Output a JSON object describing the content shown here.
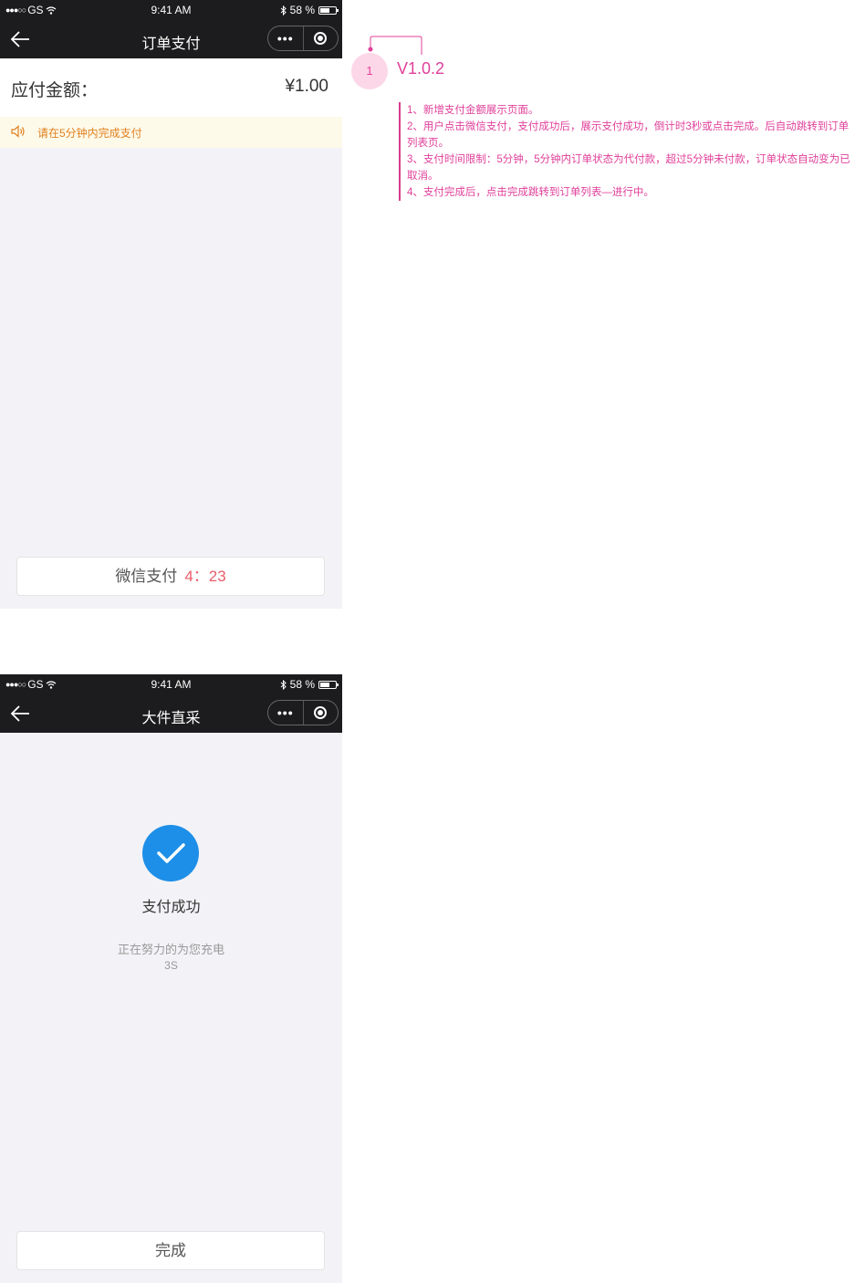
{
  "status_bar": {
    "signal": "●●●○○",
    "carrier": "GS",
    "time": "9:41 AM",
    "battery": "58 %"
  },
  "screen1": {
    "title": "订单支付",
    "amount_label": "应付金额：",
    "amount_value": "¥1.00",
    "notice": "请在5分钟内完成支付",
    "pay_button_label": "微信支付",
    "countdown": "4：23"
  },
  "screen2": {
    "title": "大件直采",
    "success_title": "支付成功",
    "charging_text": "正在努力的为您充电",
    "seconds": "3S",
    "done_button_label": "完成"
  },
  "annotation": {
    "marker": "1",
    "version": "V1.0.2",
    "notes": [
      "1、新增支付金额展示页面。",
      "2、用户点击微信支付，支付成功后，展示支付成功，倒计时3秒或点击完成。后自动跳转到订单列表页。",
      "3、支付时间限制：5分钟，5分钟内订单状态为代付款，超过5分钟未付款，订单状态自动变为已取消。",
      "4、支付完成后，点击完成跳转到订单列表—进行中。"
    ],
    "color": "#e0409a"
  },
  "colors": {
    "navbar": "#1c1c1e",
    "countdown": "#e85d6a",
    "success_blue": "#1e8fe8",
    "notice_text": "#e08020"
  }
}
